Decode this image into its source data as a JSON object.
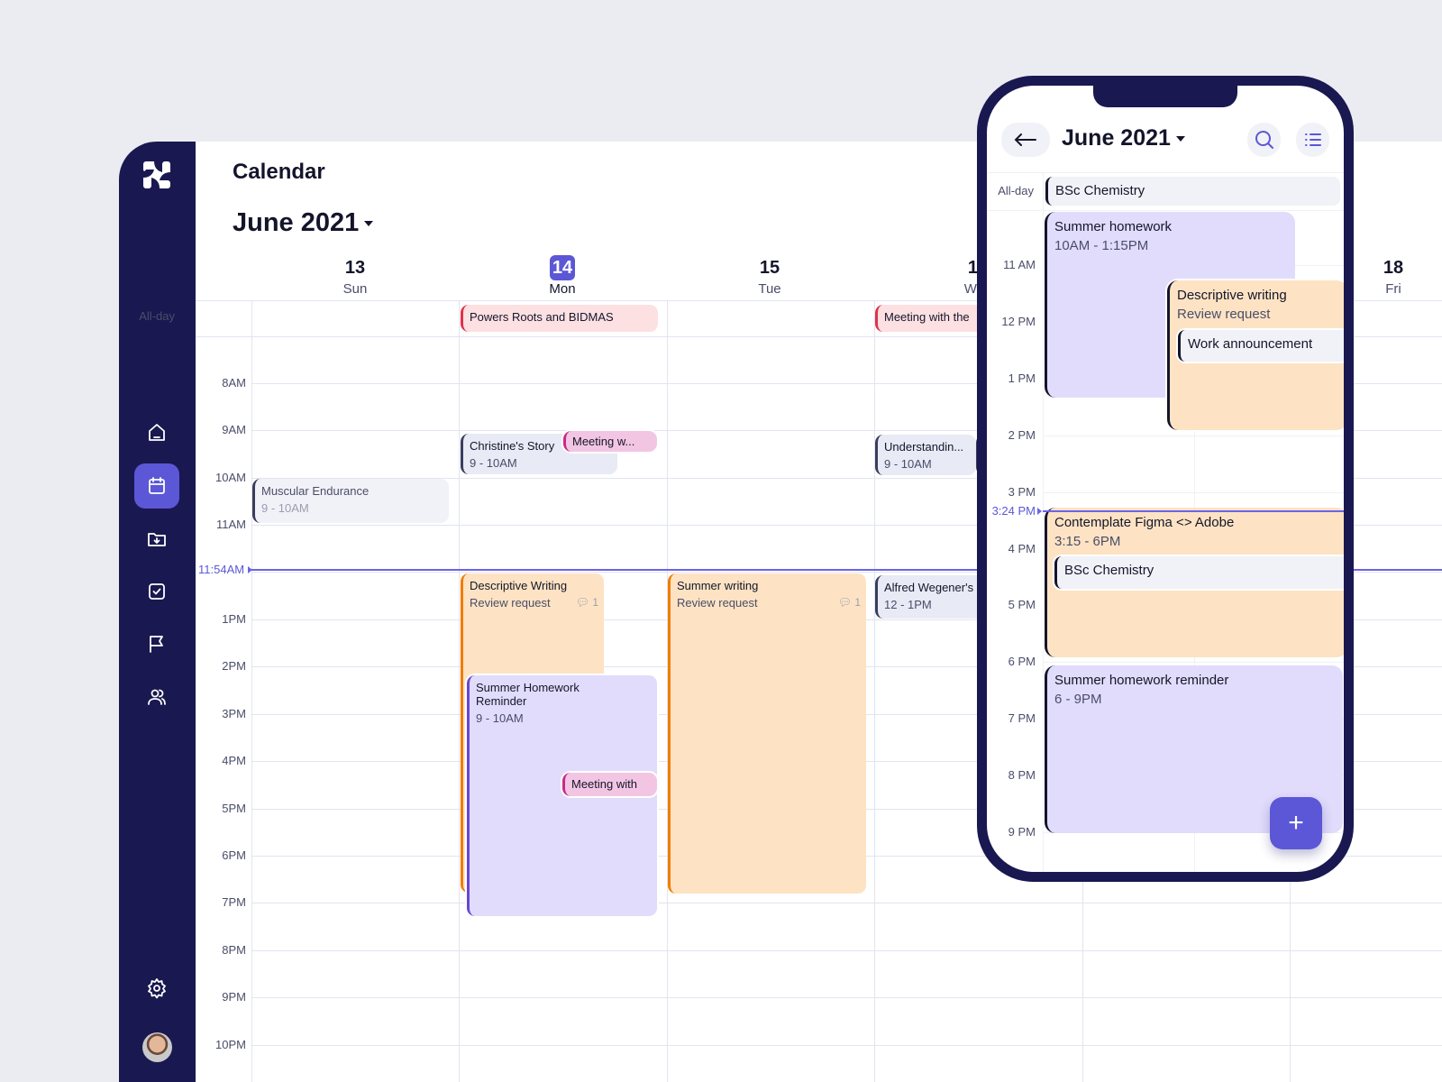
{
  "app": {
    "title": "Calendar",
    "month": "June 2021",
    "all_day_label": "All-day",
    "now_label": "11:54AM"
  },
  "sidebar": {
    "items": [
      {
        "icon": "home-icon"
      },
      {
        "icon": "calendar-icon",
        "active": true
      },
      {
        "icon": "folder-download-icon"
      },
      {
        "icon": "checkbox-icon"
      },
      {
        "icon": "flag-icon"
      },
      {
        "icon": "users-icon"
      }
    ],
    "settings_icon": "gear-icon",
    "accent": "#5b57d6",
    "bg": "#1a1850"
  },
  "days": [
    {
      "num": "13",
      "name": "Sun"
    },
    {
      "num": "14",
      "name": "Mon",
      "today": true
    },
    {
      "num": "15",
      "name": "Tue"
    },
    {
      "num": "16",
      "name": "Wed"
    },
    {
      "num": "18",
      "name": "Fri"
    }
  ],
  "hours": [
    "8AM",
    "9AM",
    "10AM",
    "11AM",
    "1PM",
    "2PM",
    "3PM",
    "4PM",
    "5PM",
    "6PM",
    "7PM",
    "8PM",
    "9PM",
    "10PM"
  ],
  "events": {
    "allday_mon": "Powers Roots and BIDMAS",
    "allday_wed": "Meeting with the",
    "christine": {
      "title": "Christine's Story",
      "time": "9 - 10AM"
    },
    "meeting1": "Meeting w...",
    "muscular": {
      "title": "Muscular Endurance",
      "time": "9 - 10AM"
    },
    "understanding": {
      "title": "Understandin...",
      "time": "9 - 10AM"
    },
    "desc_writing": {
      "title": "Descriptive Writing",
      "sub": "Review request",
      "comments": "1"
    },
    "summer_writing": {
      "title": "Summer writing",
      "sub": "Review request",
      "comments": "1"
    },
    "alfred": {
      "title": "Alfred Wegener's",
      "time": "12 - 1PM"
    },
    "summer_hw": {
      "title": "Summer Homework Reminder",
      "time": "9 - 10AM"
    },
    "meeting2": "Meeting with"
  },
  "phone": {
    "month": "June 2021",
    "all_day_label": "All-day",
    "all_day_event": "BSc Chemistry",
    "hours": [
      "11 AM",
      "12 PM",
      "1 PM",
      "2 PM",
      "3 PM",
      "4 PM",
      "5 PM",
      "6 PM",
      "7 PM",
      "8 PM",
      "9 PM"
    ],
    "now_label": "3:24 PM",
    "events": {
      "summer_hw": {
        "title": "Summer homework",
        "time": "10AM - 1:15PM"
      },
      "desc": {
        "title": "Descriptive writing",
        "sub": "Review request"
      },
      "work": "Work announcement",
      "figma": {
        "title": "Contemplate Figma <> Adobe",
        "time": "3:15 - 6PM"
      },
      "bsc": "BSc Chemistry",
      "reminder": {
        "title": "Summer homework reminder",
        "time": "6 - 9PM"
      }
    },
    "fab": "+"
  }
}
